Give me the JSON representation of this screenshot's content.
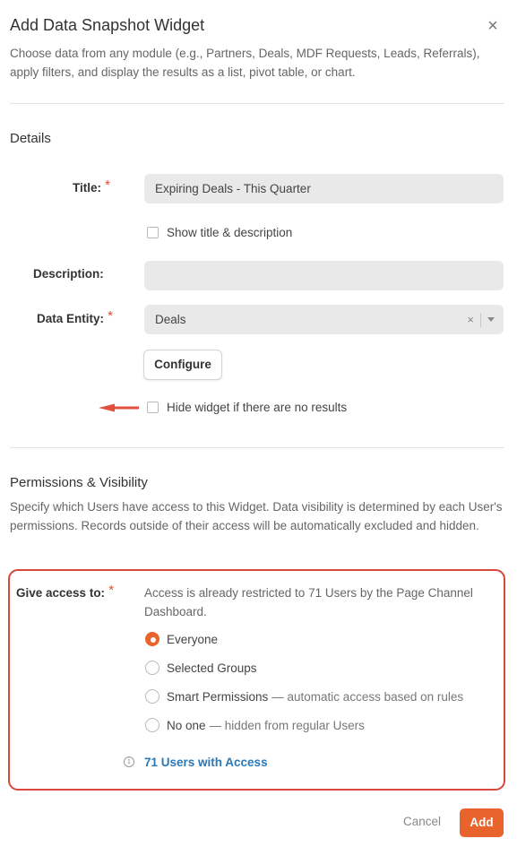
{
  "modal": {
    "title": "Add Data Snapshot Widget",
    "close_icon": "close-icon",
    "intro": "Choose data from any module (e.g., Partners, Deals, MDF Requests, Leads, Referrals), apply filters, and display the results as a list, pivot table, or chart."
  },
  "details": {
    "heading": "Details",
    "title_label": "Title:",
    "title_value": "Expiring Deals - This Quarter",
    "show_title_desc_label": "Show title & description",
    "description_label": "Description:",
    "description_value": "",
    "data_entity_label": "Data Entity:",
    "data_entity_value": "Deals",
    "clear_icon": "×",
    "configure_label": "Configure",
    "hide_widget_label": "Hide widget if there are no results",
    "required_mark": "*"
  },
  "permissions": {
    "heading": "Permissions & Visibility",
    "description": "Specify which Users have access to this Widget. Data visibility is determined by each User's permissions. Records outside of their access will be automatically excluded and hidden.",
    "access_label": "Give access to:",
    "access_note": "Access is already restricted to 71 Users by the Page Channel Dashboard.",
    "options": [
      {
        "label": "Everyone",
        "hint": "",
        "selected": true
      },
      {
        "label": "Selected Groups",
        "hint": "",
        "selected": false
      },
      {
        "label": "Smart Permissions",
        "hint": "— automatic access based on rules",
        "selected": false
      },
      {
        "label": "No one",
        "hint": "— hidden from regular Users",
        "selected": false
      }
    ],
    "users_link": "71 Users with Access"
  },
  "footer": {
    "cancel_label": "Cancel",
    "add_label": "Add"
  },
  "colors": {
    "accent": "#e8642c",
    "highlight_border": "#d9473a",
    "link": "#2a78b8",
    "required": "#e14b31"
  }
}
